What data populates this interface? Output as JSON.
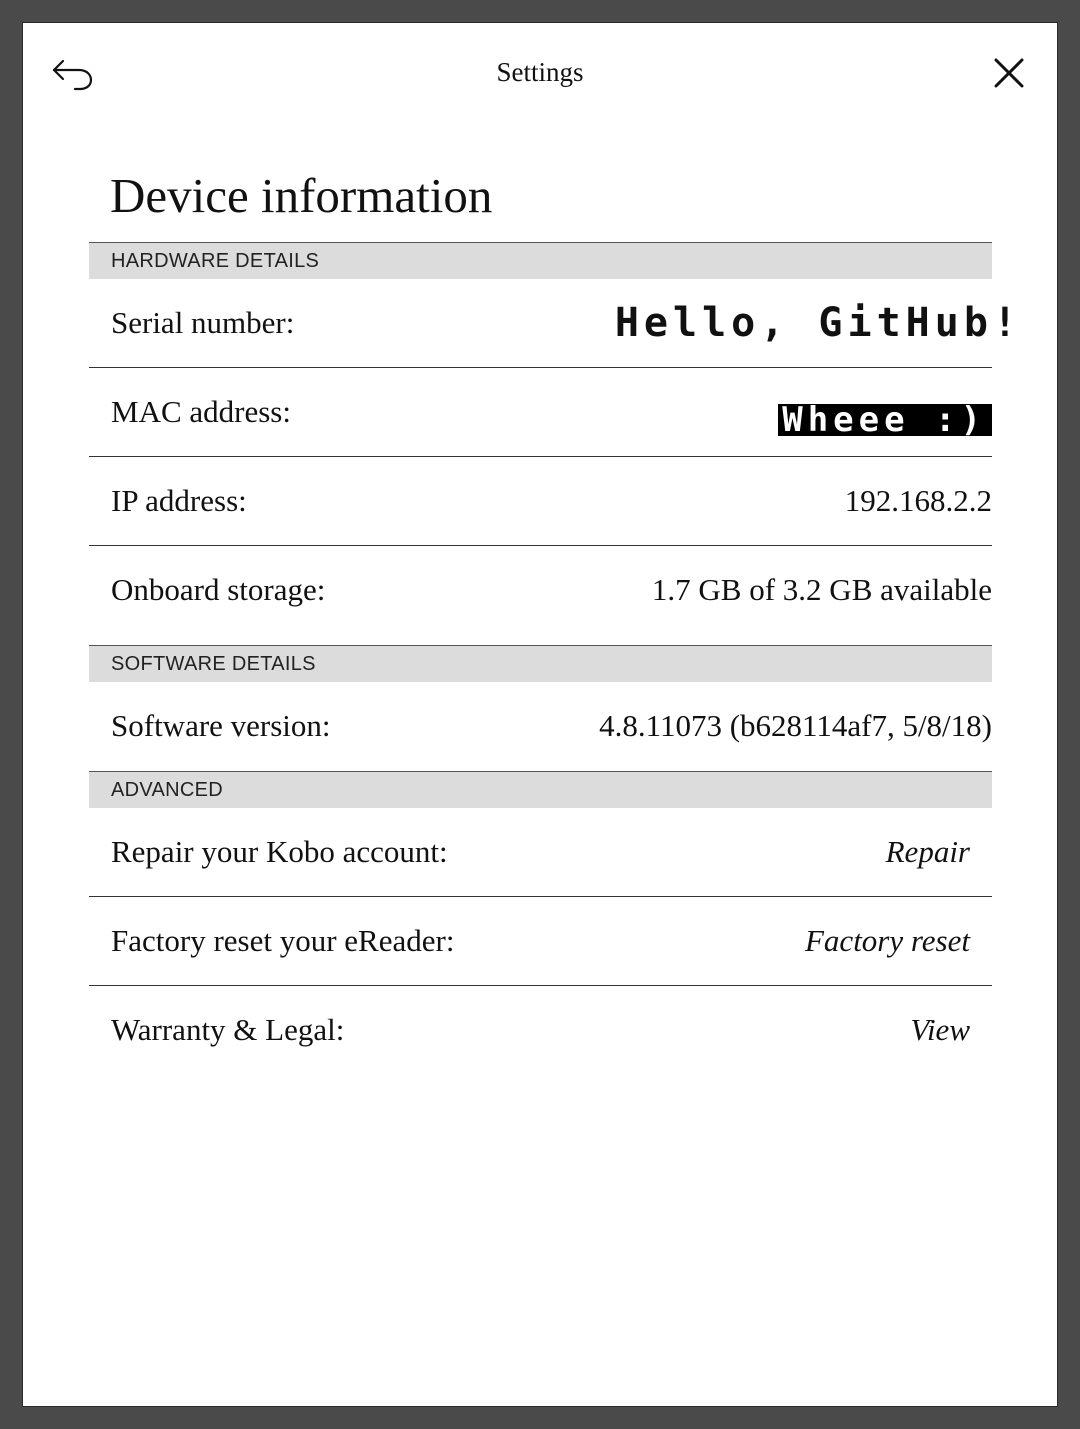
{
  "topbar": {
    "title": "Settings",
    "back_icon": "back-arrow-icon",
    "close_icon": "close-icon"
  },
  "page": {
    "title": "Device information"
  },
  "hardware": {
    "header": "HARDWARE DETAILS",
    "serial_label": "Serial number:",
    "serial_value": "Hello, GitHub!",
    "mac_label": "MAC address:",
    "mac_value": "Wheee :)",
    "ip_label": "IP address:",
    "ip_value": "192.168.2.2",
    "storage_label": "Onboard storage:",
    "storage_value": "1.7 GB of 3.2 GB available"
  },
  "software": {
    "header": "SOFTWARE DETAILS",
    "version_label": "Software version:",
    "version_value": "4.8.11073 (b628114af7, 5/8/18)"
  },
  "advanced": {
    "header": "ADVANCED",
    "repair_label": "Repair your Kobo account:",
    "repair_action": "Repair",
    "reset_label": "Factory reset your eReader:",
    "reset_action": "Factory reset",
    "legal_label": "Warranty & Legal:",
    "legal_action": "View"
  },
  "colors": {
    "background": "#ffffff",
    "section_header": "#dcdcdc",
    "frame": "#4a4a4a",
    "text": "#111111"
  }
}
